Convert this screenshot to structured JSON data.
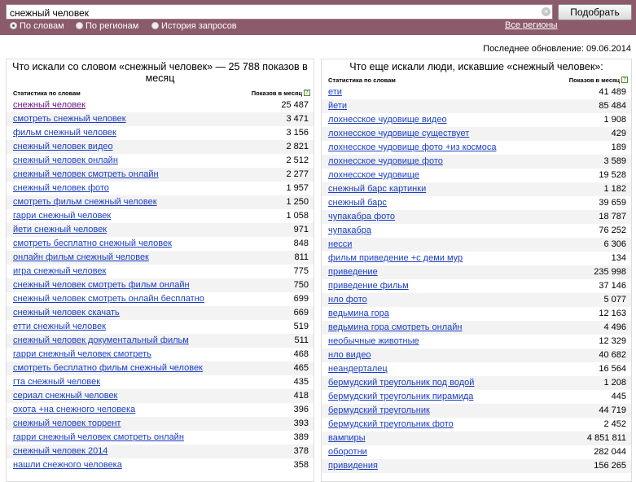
{
  "search": {
    "value": "снежный человек",
    "button_label": "Подобрать"
  },
  "modes": [
    {
      "label": "По словам",
      "selected": true
    },
    {
      "label": "По регионам",
      "selected": false
    },
    {
      "label": "История запросов",
      "selected": false
    }
  ],
  "regions_link": "Все регионы",
  "updated_text": "Последнее обновление: 09.06.2014",
  "left": {
    "title": "Что искали со словом «снежный человек» — 25 788 показов в месяц",
    "col_query": "Статистика по словам",
    "col_count": "Показов в месяц",
    "rows": [
      {
        "q": "снежный человек",
        "n": "25 487"
      },
      {
        "q": "смотреть снежный человек",
        "n": "3 471"
      },
      {
        "q": "фильм снежный человек",
        "n": "3 156"
      },
      {
        "q": "снежный человек видео",
        "n": "2 821"
      },
      {
        "q": "снежный человек онлайн",
        "n": "2 512"
      },
      {
        "q": "снежный человек смотреть онлайн",
        "n": "2 277"
      },
      {
        "q": "снежный человек фото",
        "n": "1 957"
      },
      {
        "q": "смотреть фильм снежный человек",
        "n": "1 250"
      },
      {
        "q": "гарри снежный человек",
        "n": "1 058"
      },
      {
        "q": "йети снежный человек",
        "n": "971"
      },
      {
        "q": "смотреть бесплатно снежный человек",
        "n": "848"
      },
      {
        "q": "онлайн фильм снежный человек",
        "n": "811"
      },
      {
        "q": "игра снежный человек",
        "n": "775"
      },
      {
        "q": "снежный человек смотреть фильм онлайн",
        "n": "750"
      },
      {
        "q": "снежный человек смотреть онлайн бесплатно",
        "n": "699"
      },
      {
        "q": "снежный человек скачать",
        "n": "669"
      },
      {
        "q": "етти снежный человек",
        "n": "519"
      },
      {
        "q": "снежный человек документальный фильм",
        "n": "511"
      },
      {
        "q": "гарри снежный человек смотреть",
        "n": "468"
      },
      {
        "q": "смотреть бесплатно фильм снежный человек",
        "n": "465"
      },
      {
        "q": "гта снежный человек",
        "n": "435"
      },
      {
        "q": "сериал снежный человек",
        "n": "418"
      },
      {
        "q": "охота +на снежного человека",
        "n": "396"
      },
      {
        "q": "снежный человек торрент",
        "n": "393"
      },
      {
        "q": "гарри снежный человек смотреть онлайн",
        "n": "389"
      },
      {
        "q": "снежный человек 2014",
        "n": "378"
      },
      {
        "q": "нашли снежного человека",
        "n": "358"
      }
    ]
  },
  "right": {
    "title": "Что еще искали люди, искавшие «снежный человек»:",
    "col_query": "Статистика по словам",
    "col_count": "Показов в месяц",
    "rows": [
      {
        "q": "ети",
        "n": "41 489"
      },
      {
        "q": "йети",
        "n": "85 484"
      },
      {
        "q": "лохнесское чудовище видео",
        "n": "1 908"
      },
      {
        "q": "лохнесское чудовище существует",
        "n": "429"
      },
      {
        "q": "лохнесское чудовище фото +из космоса",
        "n": "189"
      },
      {
        "q": "лохнесское чудовище фото",
        "n": "3 589"
      },
      {
        "q": "лохнесское чудовище",
        "n": "19 528"
      },
      {
        "q": "снежный барс картинки",
        "n": "1 182"
      },
      {
        "q": "снежный барс",
        "n": "39 659"
      },
      {
        "q": "чупакабра фото",
        "n": "18 787"
      },
      {
        "q": "чупакабра",
        "n": "76 252"
      },
      {
        "q": "несси",
        "n": "6 306"
      },
      {
        "q": "фильм приведение +с деми мур",
        "n": "134"
      },
      {
        "q": "приведение",
        "n": "235 998"
      },
      {
        "q": "приведение фильм",
        "n": "37 146"
      },
      {
        "q": "нло фото",
        "n": "5 077"
      },
      {
        "q": "ведьмина гора",
        "n": "12 163"
      },
      {
        "q": "ведьмина гора смотреть онлайн",
        "n": "4 496"
      },
      {
        "q": "необычные животные",
        "n": "12 329"
      },
      {
        "q": "нло видео",
        "n": "40 682"
      },
      {
        "q": "неандерталец",
        "n": "16 564"
      },
      {
        "q": "бермудский треугольник под водой",
        "n": "1 208"
      },
      {
        "q": "бермудский треугольник пирамида",
        "n": "445"
      },
      {
        "q": "бермудский треугольник",
        "n": "44 719"
      },
      {
        "q": "бермудский треугольник фото",
        "n": "2 452"
      },
      {
        "q": "вампиры",
        "n": "4 851 811"
      },
      {
        "q": "оборотни",
        "n": "282 044"
      },
      {
        "q": "привидения",
        "n": "156 265"
      }
    ]
  }
}
